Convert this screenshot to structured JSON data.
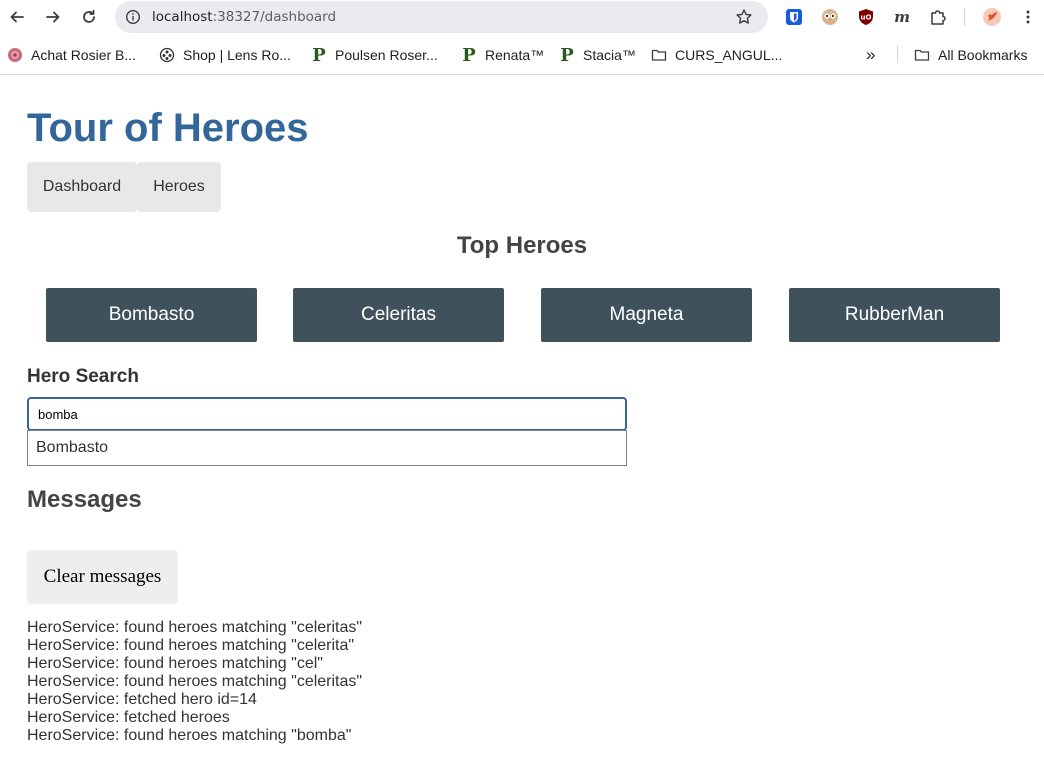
{
  "browser": {
    "url_host": "localhost",
    "url_path": ":38327/dashboard",
    "bookmarks": [
      {
        "label": "Achat Rosier B...",
        "icon": "rose-icon"
      },
      {
        "label": "Shop | Lens Ro...",
        "icon": "flower-icon"
      },
      {
        "label": "Poulsen Roser...",
        "icon": "p-logo-icon"
      },
      {
        "label": "Renata™",
        "icon": "p-logo-icon"
      },
      {
        "label": "Stacia™",
        "icon": "p-logo-icon"
      },
      {
        "label": "CURS_ANGUL...",
        "icon": "folder-icon"
      }
    ],
    "overflow_label": "»",
    "all_bookmarks_label": "All Bookmarks"
  },
  "app": {
    "title": "Tour of Heroes",
    "nav": [
      {
        "label": "Dashboard"
      },
      {
        "label": "Heroes"
      }
    ]
  },
  "dashboard": {
    "title": "Top Heroes",
    "heroes": [
      {
        "name": "Bombasto"
      },
      {
        "name": "Celeritas"
      },
      {
        "name": "Magneta"
      },
      {
        "name": "RubberMan"
      }
    ]
  },
  "search": {
    "label": "Hero Search",
    "value": "bomba",
    "results": [
      {
        "name": "Bombasto"
      }
    ]
  },
  "messages": {
    "title": "Messages",
    "clear_label": "Clear messages",
    "items": [
      "HeroService: found heroes matching \"celeritas\"",
      "HeroService: found heroes matching \"celerita\"",
      "HeroService: found heroes matching \"cel\"",
      "HeroService: found heroes matching \"celeritas\"",
      "HeroService: fetched hero id=14",
      "HeroService: fetched heroes",
      "HeroService: found heroes matching \"bomba\""
    ]
  },
  "colors": {
    "title": "#336699",
    "hero_card": "#3f525c",
    "nav_bg": "#e8e8e8"
  }
}
